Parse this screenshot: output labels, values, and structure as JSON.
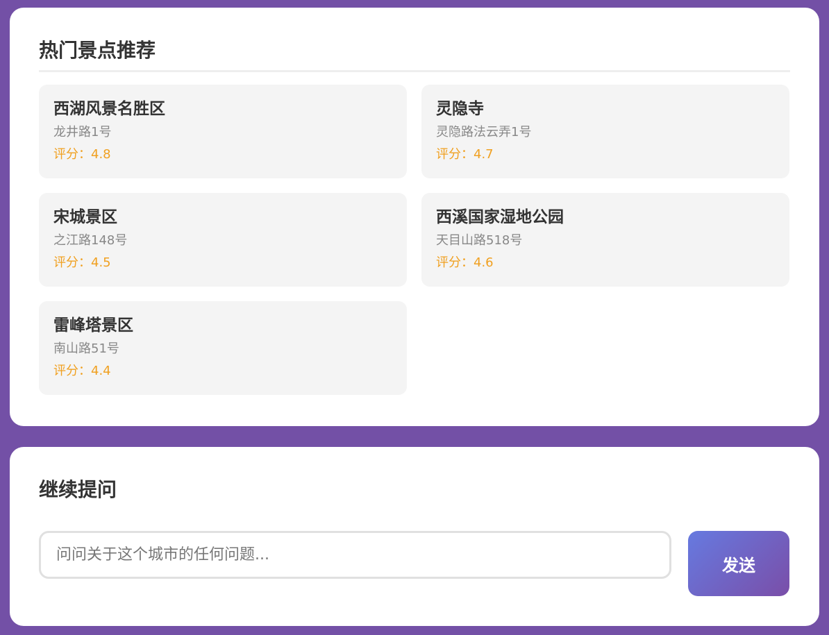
{
  "recommend": {
    "title": "热门景点推荐",
    "spots": [
      {
        "name": "西湖风景名胜区",
        "address": "龙井路1号",
        "rating": "评分：4.8"
      },
      {
        "name": "灵隐寺",
        "address": "灵隐路法云弄1号",
        "rating": "评分：4.7"
      },
      {
        "name": "宋城景区",
        "address": "之江路148号",
        "rating": "评分：4.5"
      },
      {
        "name": "西溪国家湿地公园",
        "address": "天目山路518号",
        "rating": "评分：4.6"
      },
      {
        "name": "雷峰塔景区",
        "address": "南山路51号",
        "rating": "评分：4.4"
      }
    ]
  },
  "ask": {
    "title": "继续提问",
    "input_value": "",
    "placeholder": "问问关于这个城市的任何问题...",
    "send_label": "发送"
  },
  "colors": {
    "background": "#7350a6",
    "rating": "#f0a020",
    "button_gradient_start": "#667ae0",
    "button_gradient_end": "#7a4ea8"
  }
}
